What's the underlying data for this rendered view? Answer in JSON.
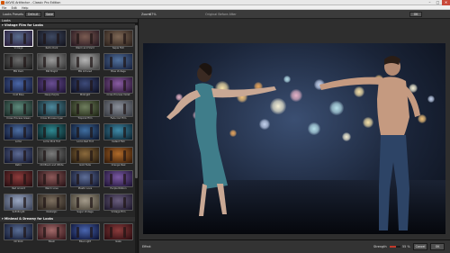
{
  "window": {
    "title": "AKVIS Artifactor - Classic Pro Edition",
    "min": "–",
    "max": "□",
    "close": "✕"
  },
  "menu": [
    "File",
    "Edit",
    "Help"
  ],
  "toolbar": {
    "preset_label": "Looks Presets",
    "preset_value": "Default",
    "save_label": "Save",
    "zoom_label": "Zoom",
    "zoom_value": "67%",
    "view_label": "Original  Before  After",
    "ok_label": "OK"
  },
  "panel": {
    "title": "Looks",
    "section1": "▾ Vintage Film for Looks",
    "section2": "▾ Minimal & Dreamy for Looks",
    "presets": [
      {
        "name": "Vintage",
        "c1": "#5a6e8e",
        "c2": "#2b1f3d"
      },
      {
        "name": "Retro Dark",
        "c1": "#3f4a63",
        "c2": "#15161f"
      },
      {
        "name": "Warm and Vivid",
        "c1": "#7b5c52",
        "c2": "#2a1a22"
      },
      {
        "name": "Sepia Film",
        "c1": "#7e6755",
        "c2": "#2f241e"
      },
      {
        "name": "BW Dark",
        "c1": "#6c6c6c",
        "c2": "#1d1d1d"
      },
      {
        "name": "BW Bright",
        "c1": "#9a9a9a",
        "c2": "#383838"
      },
      {
        "name": "BW Infrared",
        "c1": "#b4b4b4",
        "c2": "#4a4a4a"
      },
      {
        "name": "Blue Vintage",
        "c1": "#52729e",
        "c2": "#1a2440"
      },
      {
        "name": "Cold Blue",
        "c1": "#4b67a6",
        "c2": "#141b3b"
      },
      {
        "name": "Deep Purple",
        "c1": "#6a4e92",
        "c2": "#21163a"
      },
      {
        "name": "Midnight",
        "c1": "#3e4b7a",
        "c2": "#0f1226"
      },
      {
        "name": "Cross Process Violet",
        "c1": "#8a5ca3",
        "c2": "#2b1735"
      },
      {
        "name": "Cross Process Green",
        "c1": "#5e8a7c",
        "c2": "#1a2b27"
      },
      {
        "name": "Cross Process Cyan",
        "c1": "#4f8a9e",
        "c2": "#15292f"
      },
      {
        "name": "Tropical Film",
        "c1": "#6f7e5e",
        "c2": "#222917"
      },
      {
        "name": "Fade Out Film",
        "c1": "#8a8f99",
        "c2": "#3c3f46"
      },
      {
        "name": "Lomo",
        "c1": "#4d6fa3",
        "c2": "#0e1530"
      },
      {
        "name": "Lomo Pink Tint",
        "c1": "#2f8a92",
        "c2": "#0b2226"
      },
      {
        "name": "Lomo Red Tint",
        "c1": "#3f6ea0",
        "c2": "#0f1a33"
      },
      {
        "name": "Instant Film",
        "c1": "#3f8aa8",
        "c2": "#0e2633"
      },
      {
        "name": "Retro",
        "c1": "#5d6a93",
        "c2": "#151a33"
      },
      {
        "name": "Old Black and White",
        "c1": "#7b7b7b",
        "c2": "#262626"
      },
      {
        "name": "Gold Fade",
        "c1": "#8b6a3c",
        "c2": "#2a1e10"
      },
      {
        "name": "Orange Peel",
        "c1": "#b06a2a",
        "c2": "#3a1e0a"
      },
      {
        "name": "Red Accent",
        "c1": "#8e3c3c",
        "c2": "#2a0f12"
      },
      {
        "name": "Warm Love",
        "c1": "#8e5a5a",
        "c2": "#2c1619"
      },
      {
        "name": "Plastic Love",
        "c1": "#5f6f99",
        "c2": "#161b33"
      },
      {
        "name": "Purple Ribbon",
        "c1": "#7b5aa3",
        "c2": "#22163a"
      },
      {
        "name": "Soft Bright",
        "c1": "#9aa7c2",
        "c2": "#3f475c"
      },
      {
        "name": "Nostalgic",
        "c1": "#7e7060",
        "c2": "#2d2620"
      },
      {
        "name": "Sugar Vintage",
        "c1": "#a39a8a",
        "c2": "#4a4438"
      },
      {
        "name": "Vintage Film",
        "c1": "#6a5e7e",
        "c2": "#201a2e"
      }
    ],
    "presets2": [
      {
        "name": "Oil Slick",
        "c1": "#5a6e96",
        "c2": "#141b34"
      },
      {
        "name": "Blush",
        "c1": "#a36a6a",
        "c2": "#3a1a1e"
      },
      {
        "name": "Blue Light",
        "c1": "#4a66b0",
        "c2": "#0e1538"
      },
      {
        "name": "Gaze",
        "c1": "#8a3c3c",
        "c2": "#300e12"
      }
    ]
  },
  "bottom": {
    "status": "Effect",
    "strength_label": "Strength",
    "strength_value": "55 %",
    "strength_fraction": 0.55,
    "cancel_label": "Cancel",
    "ok_label": "OK"
  },
  "colors": {
    "accent": "#c0392b",
    "bokeh": [
      "#f7e2a8",
      "#f2c27a",
      "#e9a65c",
      "#f5f0d6",
      "#e7b3c7",
      "#c5d3ee",
      "#b7e0ea"
    ]
  }
}
